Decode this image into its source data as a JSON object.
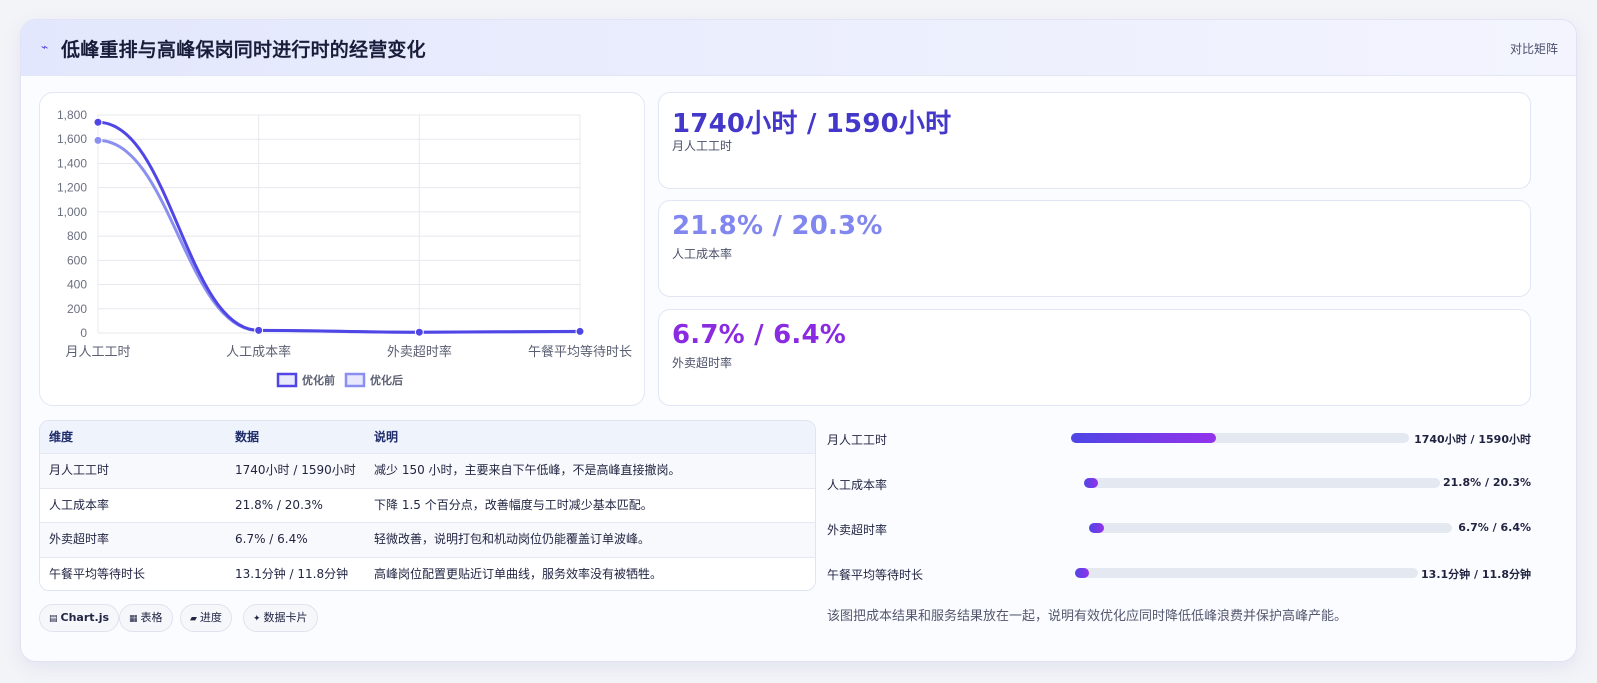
{
  "header": {
    "icon": "trend-icon",
    "title": "低峰重排与高峰保岗同时进行时的经营变化",
    "link": "对比矩阵"
  },
  "chart_data": {
    "type": "line",
    "categories": [
      "月人工工时",
      "人工成本率",
      "外卖超时率",
      "午餐平均等待时长"
    ],
    "series": [
      {
        "name": "优化前",
        "values": [
          1740,
          21.8,
          6.7,
          13.1
        ],
        "color": "#4f46e5"
      },
      {
        "name": "优化后",
        "values": [
          1590,
          20.3,
          6.4,
          11.8
        ],
        "color": "#8b90f0"
      }
    ],
    "ylim": [
      0,
      1800
    ],
    "yticks": [
      0,
      200,
      400,
      600,
      800,
      1000,
      1200,
      1400,
      1600,
      1800
    ],
    "ytick_labels": [
      "0",
      "200",
      "400",
      "600",
      "800",
      "1,000",
      "1,200",
      "1,400",
      "1,600",
      "1,800"
    ],
    "grid": true,
    "legend": "bottom"
  },
  "metrics": [
    {
      "value": "1740小时 / 1590小时",
      "label": "月人工工时",
      "color": "#4338ca"
    },
    {
      "value": "21.8% / 20.3%",
      "label": "人工成本率",
      "color": "#8187ee"
    },
    {
      "value": "6.7% / 6.4%",
      "label": "外卖超时率",
      "color": "#8a2be2"
    }
  ],
  "table": {
    "headers": [
      "维度",
      "数据",
      "说明"
    ],
    "rows": [
      [
        "月人工工时",
        "1740小时 / 1590小时",
        "减少 150 小时，主要来自下午低峰，不是高峰直接撤岗。"
      ],
      [
        "人工成本率",
        "21.8% / 20.3%",
        "下降 1.5 个百分点，改善幅度与工时减少基本匹配。"
      ],
      [
        "外卖超时率",
        "6.7% / 6.4%",
        "轻微改善，说明打包和机动岗位仍能覆盖订单波峰。"
      ],
      [
        "午餐平均等待时长",
        "13.1分钟 / 11.8分钟",
        "高峰岗位配置更贴近订单曲线，服务效率没有被牺牲。"
      ]
    ]
  },
  "tags": [
    {
      "icon": "chart-icon",
      "glyph": "▤",
      "label": "Chart.js"
    },
    {
      "icon": "table-icon",
      "glyph": "▦",
      "label": "表格"
    },
    {
      "icon": "progress-icon",
      "glyph": "▰",
      "label": "进度"
    },
    {
      "icon": "sparkle-icon",
      "glyph": "✦",
      "label": "数据卡片"
    }
  ],
  "bars": [
    {
      "label": "月人工工时",
      "value": "1740小时 / 1590小时",
      "fill": 0.43
    },
    {
      "label": "人工成本率",
      "value": "21.8% / 20.3%",
      "fill": 0.04
    },
    {
      "label": "外卖超时率",
      "value": "6.7% / 6.4%",
      "fill": 0.04
    },
    {
      "label": "午餐平均等待时长",
      "value": "13.1分钟 / 11.8分钟",
      "fill": 0.04
    }
  ],
  "note": "该图把成本结果和服务结果放在一起，说明有效优化应同时降低低峰浪费并保护高峰产能。"
}
